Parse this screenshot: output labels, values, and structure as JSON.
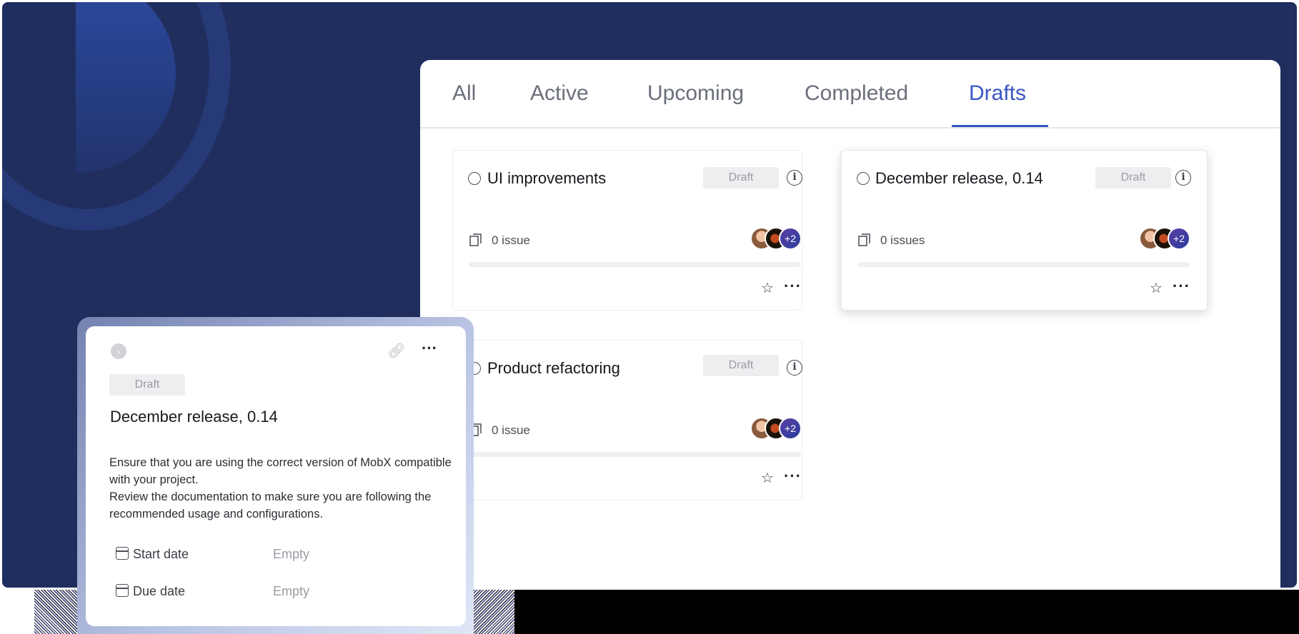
{
  "tabs": [
    {
      "label": "All",
      "active": false
    },
    {
      "label": "Active",
      "active": false
    },
    {
      "label": "Upcoming",
      "active": false
    },
    {
      "label": "Completed",
      "active": false
    },
    {
      "label": "Drafts",
      "active": true
    }
  ],
  "cards": [
    {
      "title": "UI improvements",
      "status": "Draft",
      "issues": "0 issue",
      "more_members": "+2"
    },
    {
      "title": "December release, 0.14",
      "status": "Draft",
      "issues": "0 issues",
      "more_members": "+2"
    },
    {
      "title": "Product refactoring",
      "status": "Draft",
      "issues": "0 issue",
      "more_members": "+2"
    }
  ],
  "detail": {
    "status": "Draft",
    "title": "December release, 0.14",
    "description_line1": "Ensure that you are using the correct version of MobX compatible with your project.",
    "description_line2": "Review the documentation to make sure you are following the recommended usage and configurations.",
    "start_date_label": "Start date",
    "start_date_value": "Empty",
    "due_date_label": "Due date",
    "due_date_value": "Empty"
  },
  "colors": {
    "accent": "#3a56c4",
    "background": "#202e5e"
  },
  "icons": [
    "issues-icon",
    "star-icon",
    "more-icon",
    "info-icon",
    "link-icon",
    "calendar-icon",
    "chevron-right-icon"
  ]
}
